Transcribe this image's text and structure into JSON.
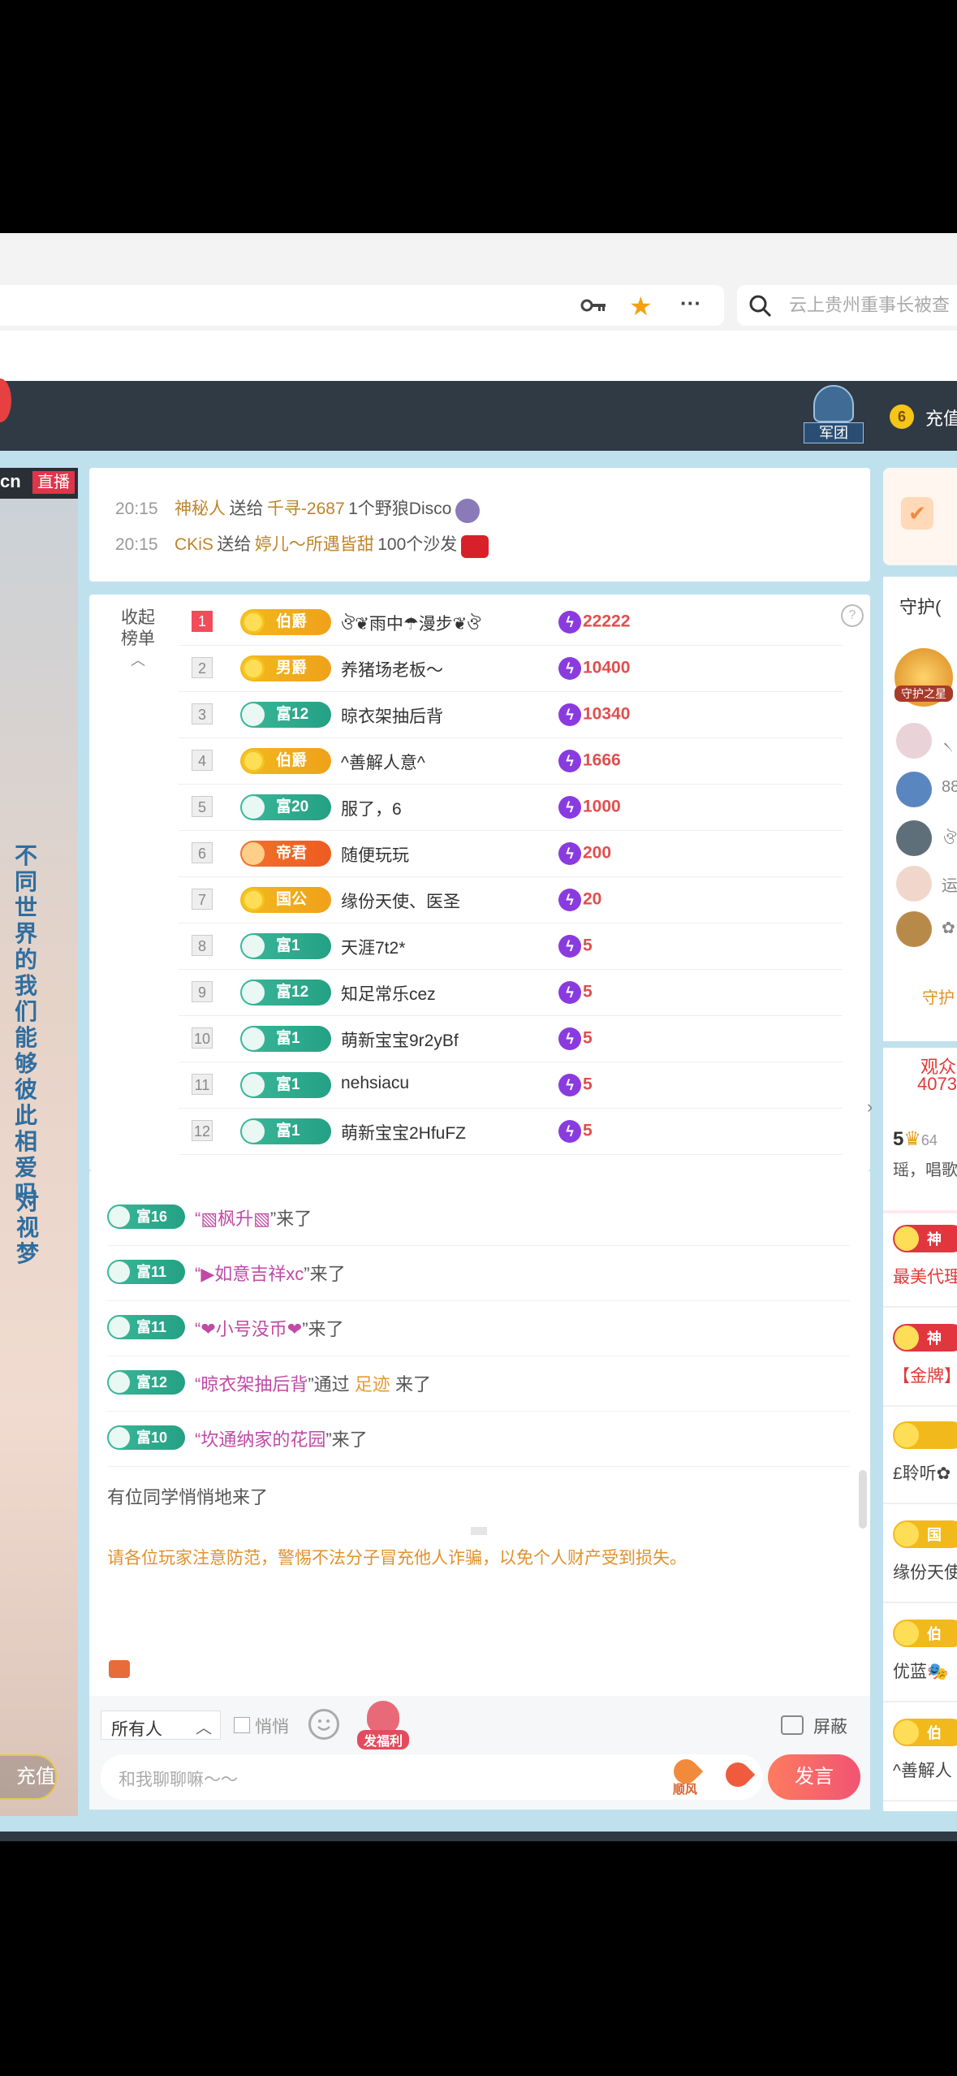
{
  "browser": {
    "search_placeholder": "云上贵州重事长被查",
    "icons": [
      "key-icon",
      "star-icon",
      "more-icon",
      "search-icon"
    ]
  },
  "header": {
    "legion_label": "军团",
    "coin_badge": "6",
    "recharge_label": "充值"
  },
  "video": {
    "badge_prefix": "cn",
    "live_label": "直播",
    "vertical_text_1": "不同世界的我们能够彼此相爱吗",
    "vertical_text_2": "对视梦",
    "recharge_button": "充值"
  },
  "gift_feed": [
    {
      "time": "20:15",
      "sender": "神秘人",
      "verb": "送给",
      "receiver": "千寻-2687",
      "gift": "1个野狼Disco"
    },
    {
      "time": "20:15",
      "sender": "CKiS",
      "verb": "送给",
      "receiver": "婷儿～所遇皆甜",
      "gift": "100个沙发"
    }
  ],
  "ranking": {
    "collapse_label_1": "收起",
    "collapse_label_2": "榜单",
    "help_icon": "?",
    "rows": [
      {
        "rank": "1",
        "badge": "伯爵",
        "style": "gold",
        "name": "ঔ❦雨中☂漫步❦ঔ",
        "score": "22222"
      },
      {
        "rank": "2",
        "badge": "男爵",
        "style": "gold",
        "name": "养猪场老板～",
        "score": "10400"
      },
      {
        "rank": "3",
        "badge": "富12",
        "style": "green",
        "name": "晾衣架抽后背",
        "score": "10340"
      },
      {
        "rank": "4",
        "badge": "伯爵",
        "style": "gold",
        "name": "^善解人意^",
        "score": "1666"
      },
      {
        "rank": "5",
        "badge": "富20",
        "style": "green",
        "name": "服了，6",
        "score": "1000"
      },
      {
        "rank": "6",
        "badge": "帝君",
        "style": "orange",
        "name": "随便玩玩",
        "score": "200"
      },
      {
        "rank": "7",
        "badge": "国公",
        "style": "gold",
        "name": "缘份天使、医圣",
        "score": "20"
      },
      {
        "rank": "8",
        "badge": "富1",
        "style": "green",
        "name": "天涯7t2*",
        "score": "5"
      },
      {
        "rank": "9",
        "badge": "富12",
        "style": "green",
        "name": "知足常乐cez",
        "score": "5"
      },
      {
        "rank": "10",
        "badge": "富1",
        "style": "green",
        "name": "萌新宝宝9r2yBf",
        "score": "5"
      },
      {
        "rank": "11",
        "badge": "富1",
        "style": "green",
        "name": "nehsiacu",
        "score": "5"
      },
      {
        "rank": "12",
        "badge": "富1",
        "style": "green",
        "name": "萌新宝宝2HfuFZ",
        "score": "5"
      }
    ]
  },
  "chat": [
    {
      "badge": "富16",
      "pre": "“",
      "name": "▧枫升▧",
      "post": "”来了",
      "via": "",
      "tail": ""
    },
    {
      "badge": "富11",
      "pre": "“",
      "name": "▶如意吉祥xc",
      "post": "”来了",
      "via": "",
      "tail": ""
    },
    {
      "badge": "富11",
      "pre": "“",
      "name": "❤小号没币❤",
      "post": "”来了",
      "via": "",
      "tail": ""
    },
    {
      "badge": "富12",
      "pre": "“",
      "name": "晾衣架抽后背",
      "post": "”通过",
      "via": "足迹",
      "tail": "来了"
    },
    {
      "badge": "富10",
      "pre": "“",
      "name": "坎通纳家的花园",
      "post": "”来了",
      "via": "",
      "tail": ""
    }
  ],
  "chat_anon": "有位同学悄悄地来了",
  "notice": "请各位玩家注意防范，警惕不法分子冒充他人诈骗，以免个人财产受到损失。",
  "input": {
    "target": "所有人",
    "whisper_label": "悄悄",
    "red_packet_label": "发福利",
    "block_label": "屏蔽",
    "placeholder": "和我聊聊嘛～～",
    "wind_label": "顺风",
    "send_label": "发言"
  },
  "right": {
    "guard_title": "守护(",
    "guard_badge": "守护之星",
    "guard_more": "守护",
    "guard_items": [
      "৲",
      "88",
      "ঔ",
      "运",
      "✿"
    ],
    "audience_label": "观众",
    "audience_count": "4073",
    "fan_prefix": "5",
    "fan_text": "64",
    "fan_msg": "瑶，唱歌",
    "rank_items": [
      {
        "tag": "神",
        "text": "最美代理"
      },
      {
        "tag": "神",
        "text": "【金牌】"
      },
      {
        "tag": "",
        "text": "£聆听✿"
      },
      {
        "tag": "国",
        "text": "缘份天使"
      },
      {
        "tag": "伯",
        "text": "优蓝🎭"
      },
      {
        "tag": "伯",
        "text": "^善解人"
      }
    ]
  }
}
